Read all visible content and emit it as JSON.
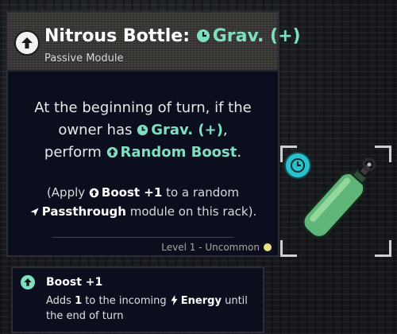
{
  "tooltip": {
    "title_prefix": "Nitrous Bottle:",
    "title_keyword": "Grav. (+)",
    "subtitle": "Passive Module",
    "effect": {
      "line1": "At the beginning of turn, if the",
      "line2_pre": "owner has",
      "line2_kw": "Grav. (+)",
      "line2_post": ",",
      "line3_pre": "perform",
      "line3_kw": "Random Boost",
      "line3_post": "."
    },
    "note": {
      "open": "(Apply",
      "boost": "Boost +1",
      "mid": "to a random",
      "kw": "Passthrough",
      "end": "module on this rack)."
    },
    "footer": "Level 1 - Uncommon"
  },
  "keyword_box": {
    "title": "Boost +1",
    "desc_pre": "Adds",
    "desc_num": "1",
    "desc_mid": "to the incoming",
    "desc_kw": "Energy",
    "desc_post": "until the end of turn"
  },
  "icons": {
    "header": "boost-arrow-icon",
    "grav": "clock-icon",
    "boost": "boost-arrow-icon",
    "passthrough": "passthrough-arrow-icon",
    "energy": "lightning-icon",
    "rarity": "rarity-dot-icon",
    "item": "nitrous-bottle-icon",
    "badge": "clock-badge-icon"
  },
  "colors": {
    "keyword": "#7ee0c0",
    "panel": "#0b0f1d",
    "rarity": "#e9df84",
    "bottle": "#5fb57a",
    "badge": "#2ac1cf"
  }
}
